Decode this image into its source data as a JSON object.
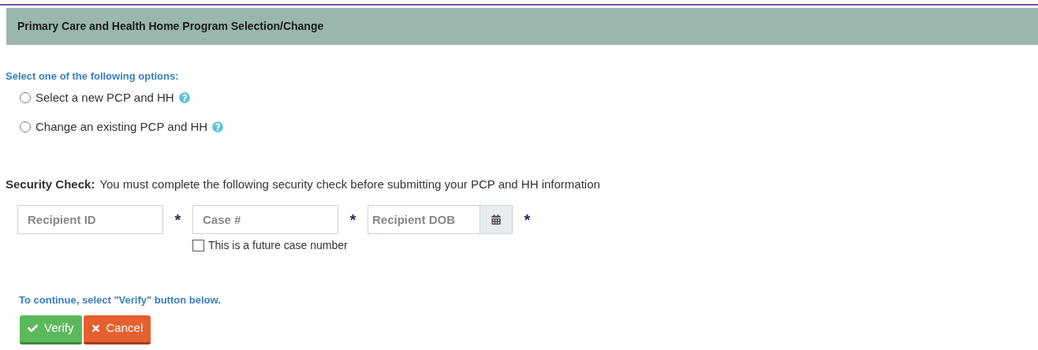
{
  "header": {
    "title": "Primary Care and Health Home Program Selection/Change"
  },
  "options": {
    "heading": "Select one of the following options:",
    "items": [
      {
        "label": "Select a new PCP and HH",
        "selected": false
      },
      {
        "label": "Change an existing PCP and HH",
        "selected": false
      }
    ]
  },
  "security": {
    "label": "Security Check:",
    "text": "You must complete the following security check before submitting your PCP and HH information",
    "fields": [
      {
        "kind": "text",
        "placeholder": "Recipient ID",
        "required_mark": "*"
      },
      {
        "kind": "text",
        "placeholder": "Case #",
        "required_mark": "*",
        "checkbox": {
          "label": "This is a future case number",
          "checked": false
        }
      },
      {
        "kind": "date",
        "placeholder": "Recipient DOB",
        "required_mark": "*"
      }
    ]
  },
  "instruction": "To continue, select \"Verify\" button below.",
  "buttons": [
    {
      "kind": "verify",
      "label": "Verify"
    },
    {
      "kind": "cancel",
      "label": "Cancel"
    }
  ]
}
